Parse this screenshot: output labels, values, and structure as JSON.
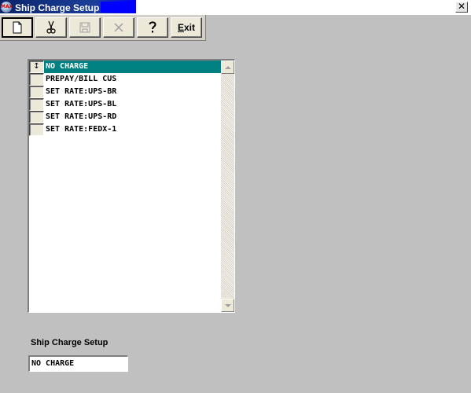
{
  "window": {
    "title": "Ship Charge Setup",
    "app_icon_text": "MAX",
    "close_glyph": "✕"
  },
  "toolbar": {
    "buttons": [
      {
        "name": "new",
        "icon": "new-document-icon",
        "enabled": true,
        "pressed": true
      },
      {
        "name": "cut",
        "icon": "scissors-icon",
        "enabled": true,
        "pressed": false
      },
      {
        "name": "save",
        "icon": "floppy-disk-icon",
        "enabled": false,
        "pressed": false
      },
      {
        "name": "delete",
        "icon": "x-mark-icon",
        "enabled": false,
        "pressed": false
      },
      {
        "name": "help",
        "icon": "question-mark-icon",
        "enabled": true,
        "pressed": false
      }
    ],
    "exit_label_accel": "E",
    "exit_label_rest": "xit"
  },
  "list": {
    "selected_index": 0,
    "selector_glyph": "↕",
    "items": [
      {
        "label": "NO CHARGE"
      },
      {
        "label": "PREPAY/BILL CUS"
      },
      {
        "label": "SET RATE:UPS-BR"
      },
      {
        "label": "SET RATE:UPS-BL"
      },
      {
        "label": "SET RATE:UPS-RD"
      },
      {
        "label": "SET RATE:FEDX-1"
      }
    ]
  },
  "field": {
    "label": "Ship Charge Setup",
    "value": "NO CHARGE"
  },
  "colors": {
    "selection": "#008080",
    "title_bar": "#0a246a",
    "background": "#c0c0c0"
  }
}
